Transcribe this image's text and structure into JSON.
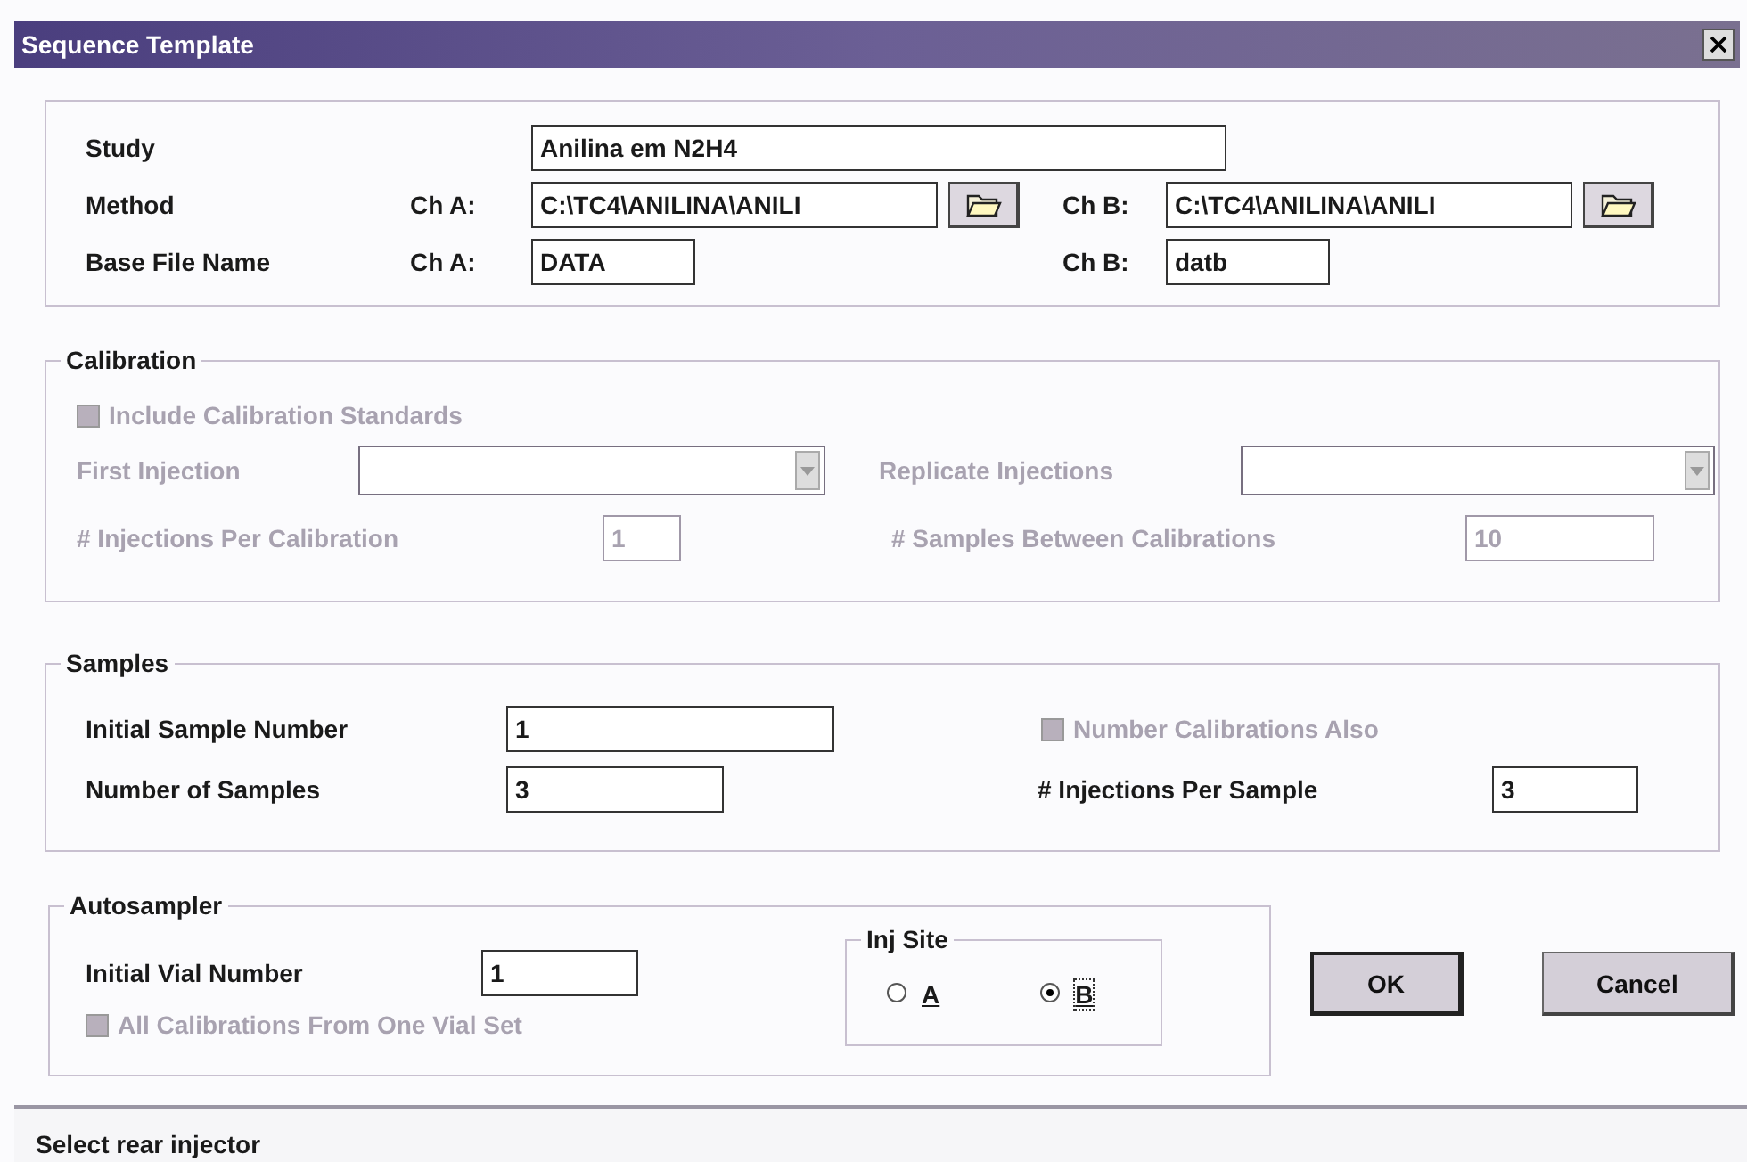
{
  "window": {
    "title": "Sequence Template"
  },
  "header": {
    "study": {
      "label": "Study",
      "value": "Anilina em N2H4"
    },
    "method": {
      "label": "Method",
      "channels": [
        {
          "label": "Ch A:",
          "value": "C:\\TC4\\ANILINA\\ANILI"
        },
        {
          "label": "Ch B:",
          "value": "C:\\TC4\\ANILINA\\ANILI"
        }
      ]
    },
    "base_file_name": {
      "label": "Base File Name",
      "channels": [
        {
          "label": "Ch A:",
          "value": "DATA"
        },
        {
          "label": "Ch B:",
          "value": "datb"
        }
      ]
    }
  },
  "calibration": {
    "title": "Calibration",
    "include_standards": {
      "label": "Include Calibration Standards",
      "checked": false,
      "disabled": true
    },
    "first_injection": {
      "label": "First Injection",
      "disabled": true
    },
    "replicate_injections": {
      "label": "Replicate Injections",
      "disabled": true
    },
    "injections_per_calibration": {
      "label": "# Injections Per Calibration",
      "value": "1",
      "disabled": true
    },
    "samples_between_calibrations": {
      "label": "# Samples Between Calibrations",
      "value": "10",
      "disabled": true
    }
  },
  "samples": {
    "title": "Samples",
    "initial_sample_number": {
      "label": "Initial Sample Number",
      "value": "1",
      "disabled": false
    },
    "number_of_samples": {
      "label": "Number of Samples",
      "value": "3",
      "disabled": false
    },
    "number_calibrations_also": {
      "label": "Number Calibrations Also",
      "checked": false,
      "disabled": true
    },
    "injections_per_sample": {
      "label": "# Injections Per Sample",
      "value": "3",
      "disabled": false
    }
  },
  "autosampler": {
    "title": "Autosampler",
    "initial_vial_number": {
      "label": "Initial Vial Number",
      "value": "1",
      "disabled": false
    },
    "all_calibrations_one_vial_set": {
      "label": "All Calibrations From One Vial Set",
      "checked": false,
      "disabled": true
    },
    "inj_site": {
      "title": "Inj Site",
      "options": [
        {
          "label": "A",
          "selected": false
        },
        {
          "label": "B",
          "selected": true
        }
      ]
    }
  },
  "buttons": [
    {
      "label": "OK",
      "default": true
    },
    {
      "label": "Cancel",
      "default": false
    }
  ],
  "status_bar": {
    "text": "Select rear injector"
  }
}
